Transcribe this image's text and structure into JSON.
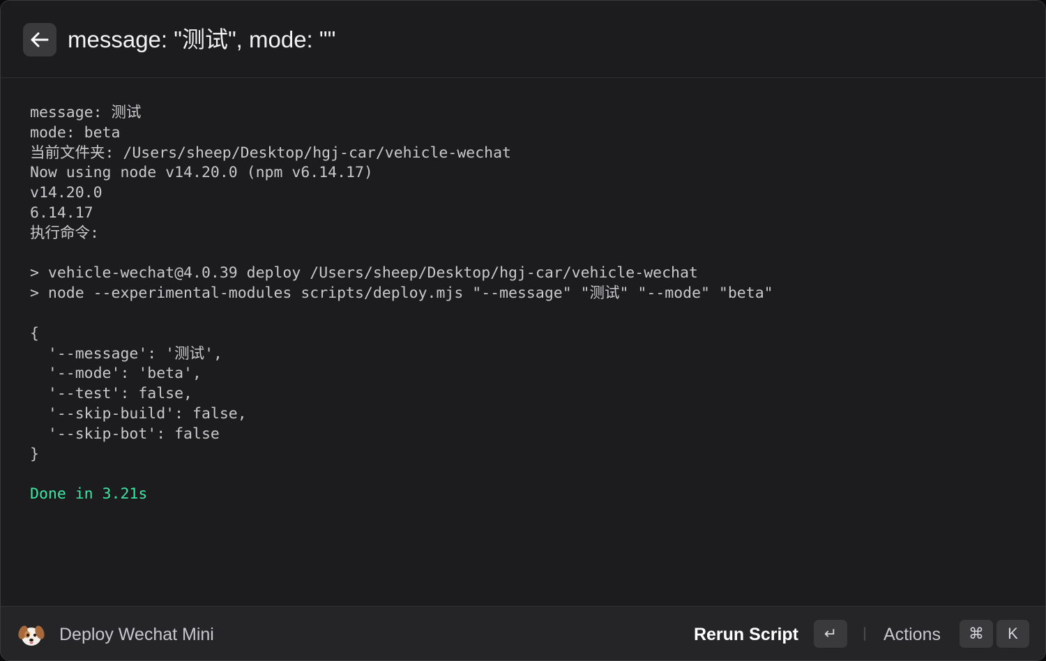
{
  "header": {
    "title": "message: \"测试\", mode: \"\""
  },
  "log": {
    "lines": [
      {
        "text": "message: 测试",
        "kind": "normal"
      },
      {
        "text": "mode: beta",
        "kind": "normal"
      },
      {
        "text": "当前文件夹: /Users/sheep/Desktop/hgj-car/vehicle-wechat",
        "kind": "normal"
      },
      {
        "text": "Now using node v14.20.0 (npm v6.14.17)",
        "kind": "normal"
      },
      {
        "text": "v14.20.0",
        "kind": "normal"
      },
      {
        "text": "6.14.17",
        "kind": "normal"
      },
      {
        "text": "执行命令:",
        "kind": "normal"
      },
      {
        "text": "",
        "kind": "blank"
      },
      {
        "text": "> vehicle-wechat@4.0.39 deploy /Users/sheep/Desktop/hgj-car/vehicle-wechat",
        "kind": "normal"
      },
      {
        "text": "> node --experimental-modules scripts/deploy.mjs \"--message\" \"测试\" \"--mode\" \"beta\"",
        "kind": "normal"
      },
      {
        "text": "",
        "kind": "blank"
      },
      {
        "text": "{",
        "kind": "normal"
      },
      {
        "text": "  '--message': '测试',",
        "kind": "normal"
      },
      {
        "text": "  '--mode': 'beta',",
        "kind": "normal"
      },
      {
        "text": "  '--test': false,",
        "kind": "normal"
      },
      {
        "text": "  '--skip-build': false,",
        "kind": "normal"
      },
      {
        "text": "  '--skip-bot': false",
        "kind": "normal"
      },
      {
        "text": "}",
        "kind": "normal"
      },
      {
        "text": "",
        "kind": "blank"
      },
      {
        "text": "Done in 3.21s",
        "kind": "success"
      }
    ],
    "success_color": "#3ee6a4"
  },
  "footer": {
    "app_icon": "puppy-face-icon",
    "app_name": "Deploy Wechat Mini",
    "primary_action_label": "Rerun Script",
    "primary_shortcut": "↵",
    "actions_label": "Actions",
    "actions_shortcut": [
      "⌘",
      "K"
    ]
  }
}
